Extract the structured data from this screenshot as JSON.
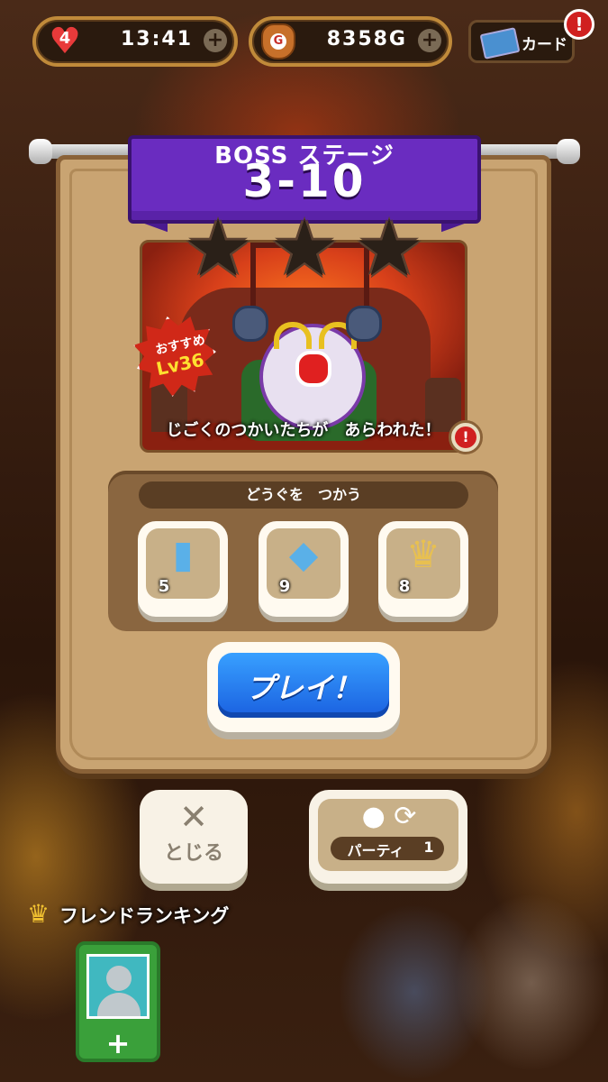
{
  "status_bar": {
    "hearts": "4",
    "stamina_timer": "13:41",
    "gold": "8358G",
    "gold_icon_letter": "G",
    "card_label": "カード",
    "alert_mark": "!",
    "plus_mark": "+"
  },
  "stage": {
    "title": "BOSS ステージ",
    "number": "3-10",
    "stars_total": 3,
    "stars_earned": 0,
    "recommended_label": "おすすめ",
    "recommended_level": "Lv36",
    "caption": "じごくのつかいたちが　あらわれた！",
    "info_mark": "!"
  },
  "items": {
    "label": "どうぐを　つかう",
    "list": [
      {
        "icon": "bottle-icon",
        "count": "5"
      },
      {
        "icon": "crystal-bag-icon",
        "count": "9"
      },
      {
        "icon": "winged-crown-icon",
        "count": "8"
      }
    ]
  },
  "play_button": {
    "label": "プレイ！"
  },
  "close_button": {
    "label": "とじる",
    "glyph": "✕"
  },
  "party_button": {
    "label": "パーティ",
    "number": "1"
  },
  "ranking": {
    "label": "フレンドランキング",
    "add_glyph": "+"
  },
  "colors": {
    "banner": "#6a2cc0",
    "play": "#1a70f0",
    "panel": "#c9a472",
    "friend_card": "#3aa03a"
  }
}
